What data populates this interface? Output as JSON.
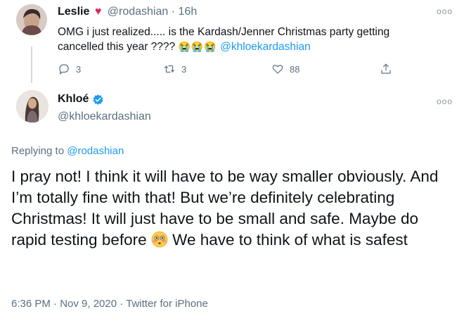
{
  "reply_tweet": {
    "name": "Leslie",
    "handle": "@rodashian",
    "separator": "·",
    "time": "16h",
    "text_before": "OMG i just realized..... is the Kardash/Jenner Christmas party getting cancelled this year ????",
    "emoji": [
      "😭",
      "😭",
      "😭"
    ],
    "mention": "@khloekardashian",
    "actions": {
      "reply_count": "3",
      "retweet_count": "3",
      "like_count": "88"
    }
  },
  "main_tweet": {
    "name": "Khloé",
    "handle": "@khloekardashian",
    "replying_prefix": "Replying to",
    "replying_to": "@rodashian",
    "text_part1": "I pray not! I think it will have to be way smaller obviously. And I’m totally fine with that! But we’re definitely celebrating Christmas! It will just have to be small and safe. Maybe do rapid testing before",
    "text_part2": "We have to think of what is safest",
    "timestamp": "6:36 PM · Nov 9, 2020 · Twitter for iPhone"
  },
  "colors": {
    "link": "#1d9bf0",
    "verified": "#1d9bf0",
    "heart": "#e0245e",
    "secondary_text": "#5b7083"
  },
  "icons": {
    "more": "more-dots-icon",
    "reply": "reply-icon",
    "retweet": "retweet-icon",
    "like": "heart-outline-icon",
    "share": "share-icon",
    "verified": "verified-badge-icon"
  }
}
